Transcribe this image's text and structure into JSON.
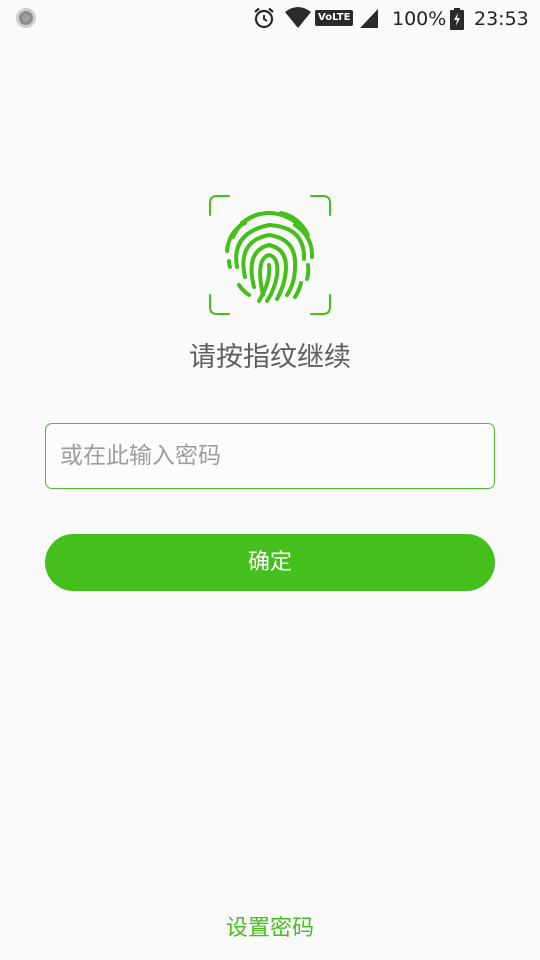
{
  "status_bar": {
    "battery_percent": "100%",
    "time": "23:53",
    "network_badge": "VoLTE",
    "icons": [
      "notification-dot-icon",
      "alarm-icon",
      "wifi-icon",
      "volte-icon",
      "cell-signal-icon",
      "battery-charging-icon"
    ]
  },
  "fingerprint": {
    "icon": "fingerprint-icon",
    "prompt": "请按指纹继续"
  },
  "password": {
    "placeholder": "或在此输入密码",
    "value": ""
  },
  "confirm_button": {
    "label": "确定"
  },
  "set_password_link": {
    "label": "设置密码"
  },
  "colors": {
    "accent": "#45bf1c",
    "background": "#fafafa",
    "prompt_text": "#5f5f5f",
    "placeholder_text": "#9d9d9d"
  }
}
